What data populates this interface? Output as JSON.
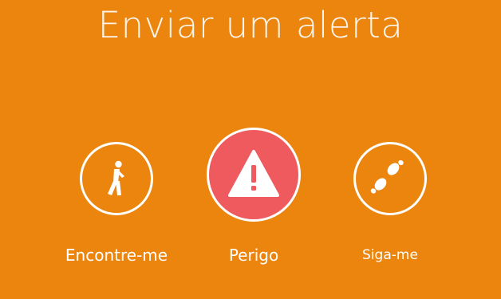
{
  "screen": {
    "title": "Enviar um alerta",
    "background_color": "#EC850E"
  },
  "actions": [
    {
      "id": "encontre-me",
      "label": "Encontre-me",
      "icon": "walking-person-icon"
    },
    {
      "id": "perigo",
      "label": "Perigo",
      "icon": "warning-triangle-icon",
      "accent_color": "#EF5A5F"
    },
    {
      "id": "siga-me",
      "label": "Siga-me",
      "icon": "footprints-icon"
    }
  ]
}
